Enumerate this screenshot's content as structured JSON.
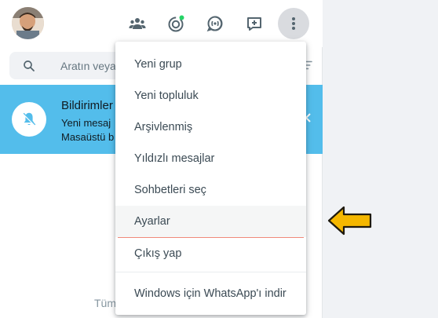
{
  "header": {
    "avatar_icon": "profile-photo",
    "buttons": [
      {
        "name": "communities-icon"
      },
      {
        "name": "status-icon"
      },
      {
        "name": "channels-icon"
      },
      {
        "name": "new-chat-icon"
      },
      {
        "name": "menu-icon"
      }
    ],
    "status_dot_color": "#25d366"
  },
  "search": {
    "placeholder": "Aratın veya"
  },
  "notification": {
    "title": "Bildirimler",
    "line1": "Yeni mesaj",
    "line2": "Masaüstü b",
    "background": "#53bdeb"
  },
  "footer": {
    "text": "Tüm"
  },
  "menu": {
    "items": [
      {
        "label": "Yeni grup"
      },
      {
        "label": "Yeni topluluk"
      },
      {
        "label": "Arşivlenmiş"
      },
      {
        "label": "Yıldızlı mesajlar"
      },
      {
        "label": "Sohbetleri seç"
      },
      {
        "label": "Ayarlar"
      },
      {
        "label": "Çıkış yap"
      },
      {
        "label": "Windows için WhatsApp'ı indir"
      }
    ],
    "highlighted": "Ayarlar"
  },
  "annotation": {
    "arrow_color": "#f5b700"
  }
}
